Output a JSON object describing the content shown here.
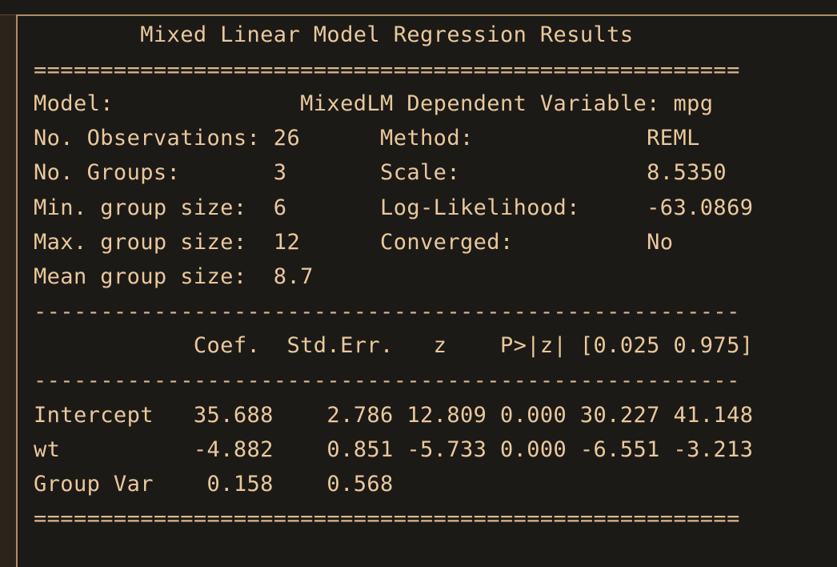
{
  "title": "        Mixed Linear Model Regression Results",
  "rule_double": "=====================================================",
  "rule_single": "-----------------------------------------------------",
  "summary_rows": [
    "Model:              MixedLM Dependent Variable: mpg",
    "No. Observations: 26      Method:             REML",
    "No. Groups:       3       Scale:              8.5350",
    "Min. group size:  6       Log-Likelihood:     -63.0869",
    "Max. group size:  12      Converged:          No",
    "Mean group size:  8.7"
  ],
  "table_header": "            Coef.  Std.Err.   z    P>|z| [0.025 0.975]",
  "table_rows": [
    "Intercept   35.688    2.786 12.809 0.000 30.227 41.148",
    "wt          -4.882    0.851 -5.733 0.000 -6.551 -3.213",
    "Group Var    0.158    0.568"
  ]
}
